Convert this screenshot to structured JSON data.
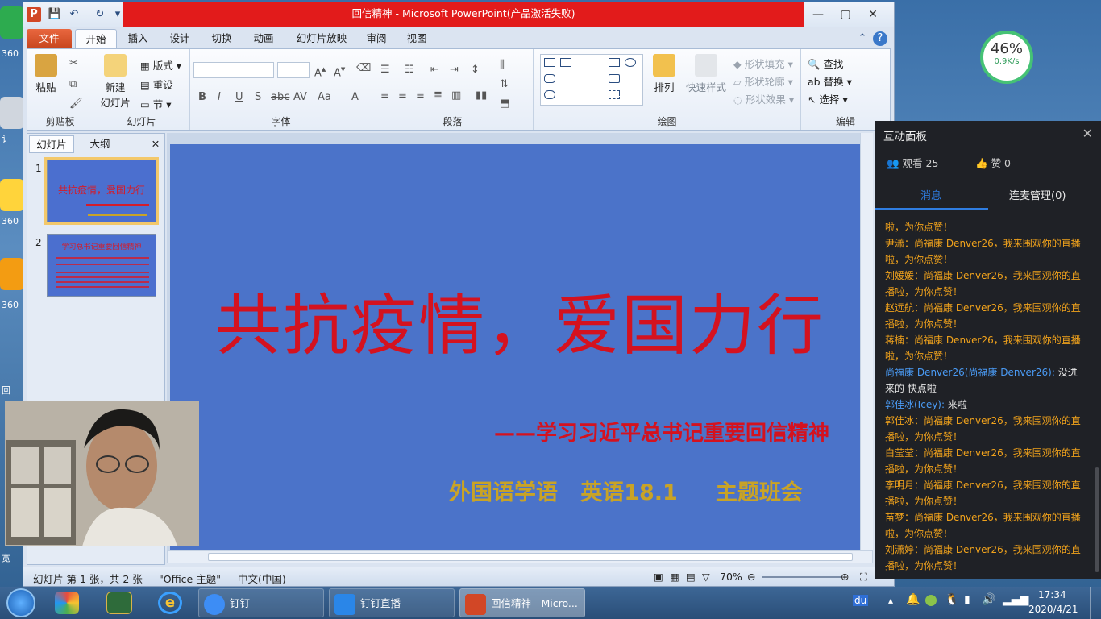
{
  "desktop": {
    "labels": [
      "360",
      "讠",
      "360",
      "360",
      "回",
      "宽"
    ]
  },
  "window": {
    "title": "回信精神  -  Microsoft PowerPoint(产品激活失败)",
    "controls": {
      "minimize": "—",
      "maximize": "▢",
      "close": "✕"
    }
  },
  "ribbon_tabs": [
    "文件",
    "开始",
    "插入",
    "设计",
    "切换",
    "动画",
    "幻灯片放映",
    "审阅",
    "视图"
  ],
  "ribbon": {
    "clipboard": {
      "paste": "粘贴",
      "label": "剪贴板"
    },
    "slides": {
      "new_slide": "新建",
      "new_slide2": "幻灯片",
      "layout": "版式",
      "reset": "重设",
      "section": "节",
      "label": "幻灯片"
    },
    "font": {
      "label": "字体"
    },
    "paragraph": {
      "label": "段落"
    },
    "drawing": {
      "arrange": "排列",
      "quick_styles": "快速样式",
      "fill": "形状填充",
      "outline": "形状轮廓",
      "effects": "形状效果",
      "label": "绘图"
    },
    "editing": {
      "find": "查找",
      "replace": "替换",
      "select": "选择",
      "label": "编辑"
    }
  },
  "left_panel": {
    "tabs": [
      "幻灯片",
      "大纲"
    ],
    "slides": [
      {
        "num": "1",
        "title": "共抗疫情，爱国力行"
      },
      {
        "num": "2",
        "title": "学习总书记重要回信精神"
      }
    ]
  },
  "slide": {
    "title": "共抗疫情，爱国力行",
    "subtitle": "——学习习近平总书记重要回信精神",
    "meta": "外国语学语   英语18.1     主题班会"
  },
  "status": {
    "slide_info": "幻灯片 第 1 张，共 2 张",
    "theme": "\"Office 主题\"",
    "language": "中文(中国)",
    "zoom": "70%"
  },
  "speed_widget": {
    "percent": "46%",
    "rate": "0.9K/s"
  },
  "panel": {
    "title": "互动面板",
    "viewers": "观看 25",
    "likes": "赞 0",
    "tabs": [
      "消息",
      "连麦管理(0)"
    ],
    "messages": [
      {
        "text": "啦，为你点赞！",
        "type": "sys"
      },
      {
        "text": "尹潇：尚福康 Denver26，我来围观你的直播啦，为你点赞！",
        "type": "sys"
      },
      {
        "text": "刘媛媛：尚福康 Denver26，我来围观你的直播啦，为你点赞！",
        "type": "sys"
      },
      {
        "text": "赵远航：尚福康 Denver26，我来围观你的直播啦，为你点赞！",
        "type": "sys"
      },
      {
        "text": "蒋楠：尚福康 Denver26，我来围观你的直播啦，为你点赞！",
        "type": "sys"
      },
      {
        "name": "尚福康 Denver26(尚福康 Denver26):",
        "text": " 没进来的 快点啦",
        "type": "chat"
      },
      {
        "name": "郭佳冰(Icey):",
        "text": " 来啦",
        "type": "chat"
      },
      {
        "text": "郭佳冰：尚福康 Denver26，我来围观你的直播啦，为你点赞！",
        "type": "sys"
      },
      {
        "text": "白莹莹：尚福康 Denver26，我来围观你的直播啦，为你点赞！",
        "type": "sys"
      },
      {
        "text": "李明月：尚福康 Denver26，我来围观你的直播啦，为你点赞！",
        "type": "sys"
      },
      {
        "text": "苗梦：尚福康 Denver26，我来围观你的直播啦，为你点赞！",
        "type": "sys"
      },
      {
        "text": "刘潇婷：尚福康 Denver26，我来围观你的直播啦，为你点赞！",
        "type": "sys"
      }
    ]
  },
  "taskbar": {
    "items": [
      "钉钉",
      "钉钉直播",
      "回信精神 - Micro..."
    ],
    "time": "17:34",
    "date": "2020/4/21"
  },
  "colors": {
    "slide_bg": "#4b73c9",
    "title_red": "#d4121f",
    "gold": "#c9a326",
    "panel_bg": "#1f2126",
    "accent_blue": "#2f7de1",
    "msg_orange": "#f0a21c"
  }
}
